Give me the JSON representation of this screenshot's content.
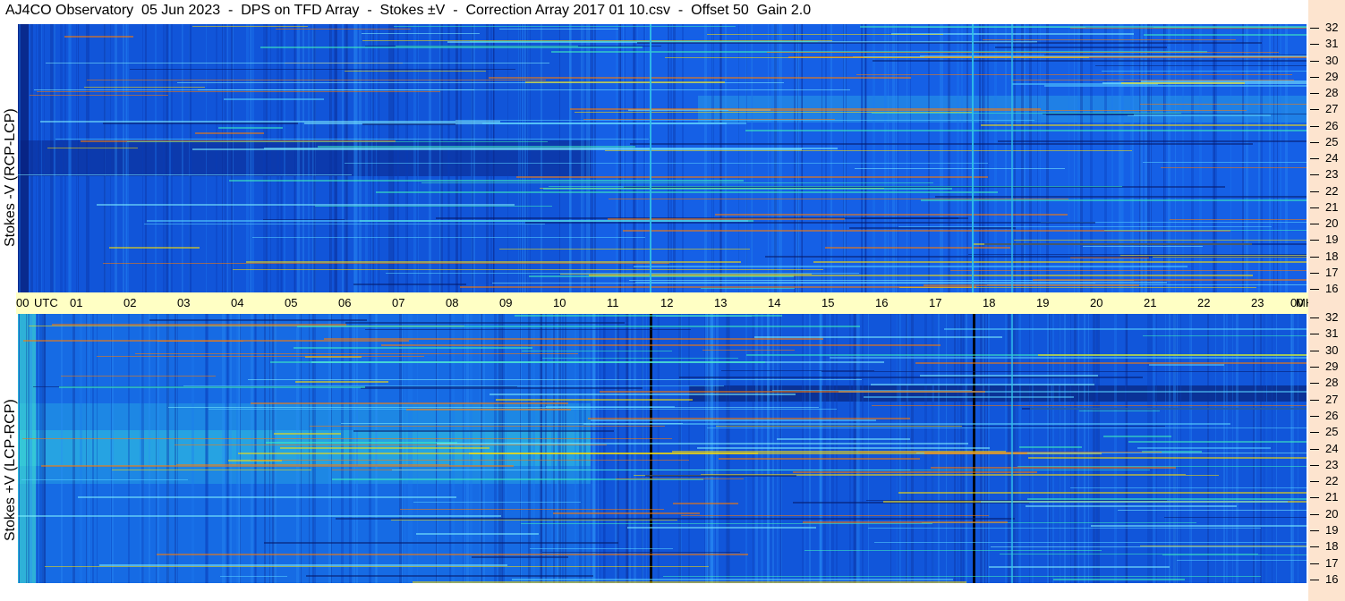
{
  "title": "AJ4CO Observatory  05 Jun 2023  -  DPS on TFD Array  -  Stokes ±V  -  Correction Array 2017 01 10.csv  -  Offset 50  Gain 2.0",
  "top_panel": {
    "label": "Stokes -V (RCP-LCP)"
  },
  "bottom_panel": {
    "label": "Stokes +V (LCP-RCP)"
  },
  "time_axis": {
    "labels": [
      "00",
      "01",
      "02",
      "03",
      "04",
      "05",
      "06",
      "07",
      "08",
      "09",
      "10",
      "11",
      "12",
      "13",
      "14",
      "15",
      "16",
      "17",
      "18",
      "19",
      "20",
      "21",
      "22",
      "23",
      "00"
    ],
    "utc_label": "UTC",
    "unit_label": "MHz"
  },
  "freq_axis": {
    "labels": [
      "32",
      "31",
      "30",
      "29",
      "28",
      "27",
      "26",
      "25",
      "24",
      "23",
      "22",
      "21",
      "20",
      "19",
      "18",
      "17",
      "16"
    ]
  },
  "colors": {
    "spectrogram_base": "#1560e6",
    "time_strip": "#ffffc4",
    "freq_strip": "#fde4cf"
  }
}
